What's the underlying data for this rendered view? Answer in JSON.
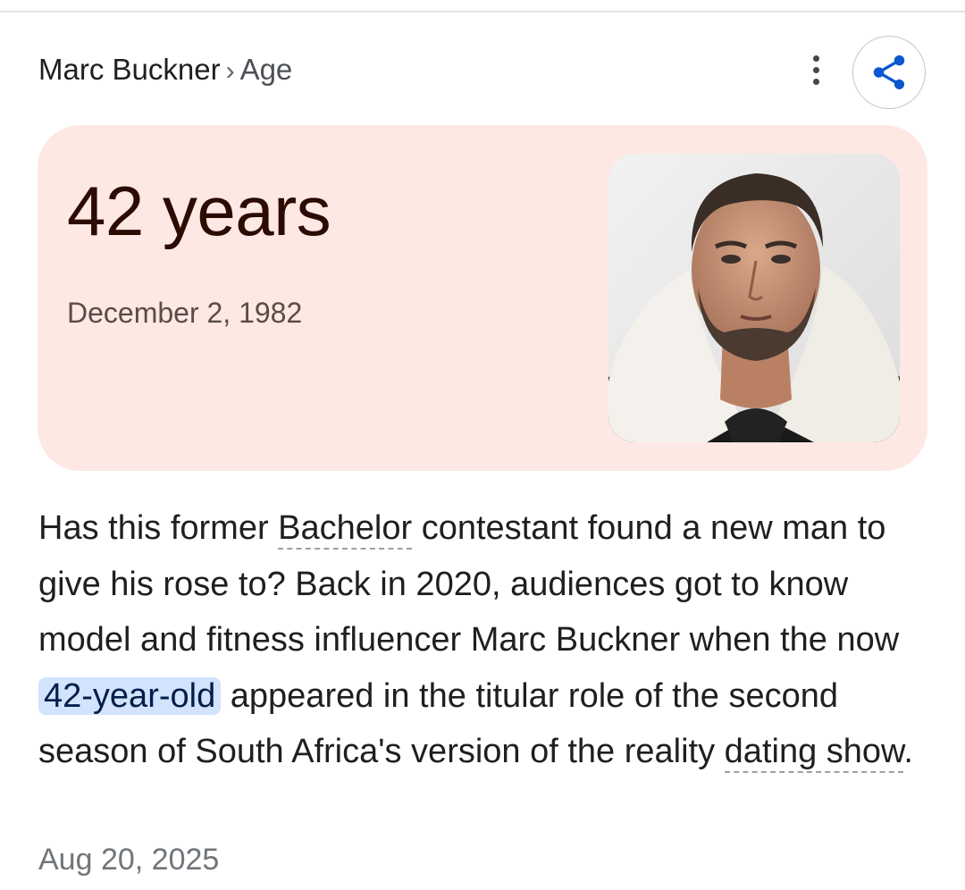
{
  "header": {
    "breadcrumb_entity": "Marc Buckner",
    "breadcrumb_separator": "›",
    "breadcrumb_attribute": "Age",
    "more_icon": "more-vert-icon",
    "share_icon": "share-icon"
  },
  "answer_card": {
    "age": "42 years",
    "birth_date": "December 2, 1982",
    "photo_alt": "Marc Buckner portrait"
  },
  "snippet": {
    "text_1": "Has this former ",
    "link_1": "Bachelor",
    "text_2": " contestant found a new man to give his rose to? Back in 2020, audiences got to know model and fitness influencer Marc Buckner when the now ",
    "highlight": "42-year-old",
    "text_3": " appeared in the titular role of the second season of South Africa's version of the reality ",
    "link_2": "dating show",
    "text_4": ".",
    "date": "Aug 20, 2025"
  },
  "colors": {
    "card_background": "#fde8e3",
    "age_text": "#2b0b02",
    "share_icon": "#0b57d0",
    "highlight_background": "#d3e3fd"
  }
}
